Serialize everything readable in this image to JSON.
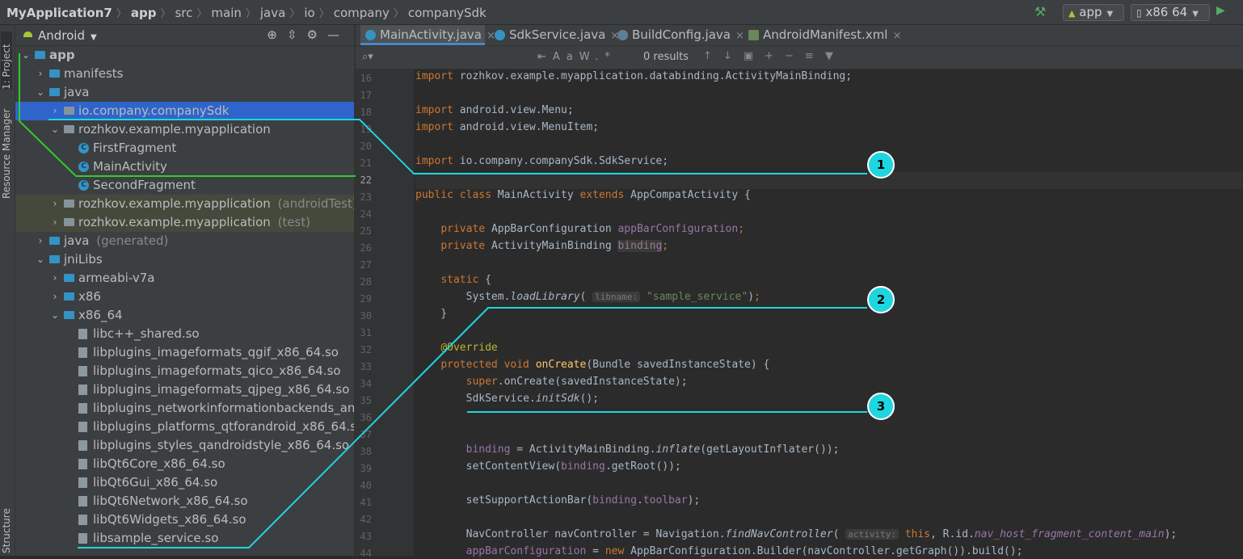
{
  "breadcrumbs": [
    "MyApplication7",
    "app",
    "src",
    "main",
    "java",
    "io",
    "company",
    "companySdk"
  ],
  "toolbar": {
    "build_icon": "hammer-icon",
    "run_config": "app",
    "device": "x86 64",
    "run_icon": "run-icon"
  },
  "left_tabs": [
    "1: Project",
    "Resource Manager",
    "Structure"
  ],
  "project_panel": {
    "view": "Android",
    "tree": [
      {
        "label": "app",
        "icon": "folder",
        "expanded": true
      },
      {
        "label": "manifests",
        "icon": "folder"
      },
      {
        "label": "java",
        "icon": "folder",
        "expanded": true
      },
      {
        "label": "io.company.companySdk",
        "icon": "package",
        "selected": true
      },
      {
        "label": "rozhkov.example.myapplication",
        "icon": "package",
        "expanded": true
      },
      {
        "label": "FirstFragment",
        "icon": "class"
      },
      {
        "label": "MainActivity",
        "icon": "class"
      },
      {
        "label": "SecondFragment",
        "icon": "class"
      },
      {
        "label": "rozhkov.example.myapplication",
        "suffix": "(androidTest)",
        "icon": "package"
      },
      {
        "label": "rozhkov.example.myapplication",
        "suffix": "(test)",
        "icon": "package"
      },
      {
        "label": "java",
        "suffix": "(generated)",
        "icon": "folder"
      },
      {
        "label": "jniLibs",
        "icon": "folder",
        "expanded": true
      },
      {
        "label": "armeabi-v7a",
        "icon": "folder"
      },
      {
        "label": "x86",
        "icon": "folder"
      },
      {
        "label": "x86_64",
        "icon": "folder",
        "expanded": true
      },
      {
        "label": "libc++_shared.so",
        "icon": "file"
      },
      {
        "label": "libplugins_imageformats_qgif_x86_64.so",
        "icon": "file"
      },
      {
        "label": "libplugins_imageformats_qico_x86_64.so",
        "icon": "file"
      },
      {
        "label": "libplugins_imageformats_qjpeg_x86_64.so",
        "icon": "file"
      },
      {
        "label": "libplugins_networkinformationbackends_andro",
        "icon": "file"
      },
      {
        "label": "libplugins_platforms_qtforandroid_x86_64.so",
        "icon": "file"
      },
      {
        "label": "libplugins_styles_qandroidstyle_x86_64.so",
        "icon": "file"
      },
      {
        "label": "libQt6Core_x86_64.so",
        "icon": "file"
      },
      {
        "label": "libQt6Gui_x86_64.so",
        "icon": "file"
      },
      {
        "label": "libQt6Network_x86_64.so",
        "icon": "file"
      },
      {
        "label": "libQt6Widgets_x86_64.so",
        "icon": "file"
      },
      {
        "label": "libsample_service.so",
        "icon": "file"
      }
    ]
  },
  "editor": {
    "tabs": [
      {
        "label": "MainActivity.java",
        "active": true
      },
      {
        "label": "SdkService.java"
      },
      {
        "label": "BuildConfig.java"
      },
      {
        "label": "AndroidManifest.xml"
      }
    ],
    "find": {
      "results": "0 results",
      "match_case": "Aa",
      "words": "W"
    },
    "line_numbers": [
      "16",
      "17",
      "18",
      "19",
      "20",
      "21",
      "22",
      "23",
      "24",
      "25",
      "26",
      "27",
      "28",
      "29",
      "30",
      "31",
      "32",
      "33",
      "34",
      "35",
      "36",
      "37",
      "38",
      "39",
      "40",
      "41",
      "42",
      "43",
      "44"
    ],
    "code": {
      "l16": "rozhkov.example.myapplication.databinding.ActivityMainBinding;",
      "l18": "android.view.Menu;",
      "l19": "android.view.MenuItem;",
      "l21": "io.company.companySdk.SdkService;",
      "l23_class": "MainActivity",
      "l23_parent": "AppCompatActivity {",
      "l25_type": "AppBarConfiguration ",
      "l25_field": "appBarConfiguration",
      "l26_type": "ActivityMainBinding ",
      "l26_field": "binding",
      "l29_recv": "System.",
      "l29_method": "loadLibrary",
      "l29_hint": "libname:",
      "l29_arg": "\"sample_service\"",
      "l32": "@Override",
      "l33_method": "onCreate",
      "l33_params": "(Bundle savedInstanceState) {",
      "l34": ".onCreate(savedInstanceState);",
      "l35_recv": "SdkService.",
      "l35_method": "initSdk",
      "l35_tail": "();",
      "l38_field": "binding",
      "l38_mid": " = ActivityMainBinding.",
      "l38_method": "inflate",
      "l38_tail": "(getLayoutInflater());",
      "l39_pre": "setContentView(",
      "l39_field": "binding",
      "l39_tail": ".getRoot());",
      "l41_pre": "setSupportActionBar(",
      "l41_field": "binding",
      "l41_mid": ".",
      "l41_field2": "toolbar",
      "l41_tail": ");",
      "l43_pre": "NavController navController = Navigation.",
      "l43_method": "findNavController",
      "l43_hint": "activity:",
      "l43_mid": ", R.id.",
      "l43_field": "nav_host_fragment_content_main",
      "l43_tail": ");",
      "l44_field": "appBarConfiguration",
      "l44_mid": " = ",
      "l44_tail": " AppBarConfiguration.Builder(navController.getGraph()).build();"
    }
  },
  "callouts": [
    "1",
    "2",
    "3"
  ],
  "colors": {
    "callout": "#1ed6e0",
    "selection": "#2f65ca",
    "connector_green": "#2ecc2e"
  }
}
